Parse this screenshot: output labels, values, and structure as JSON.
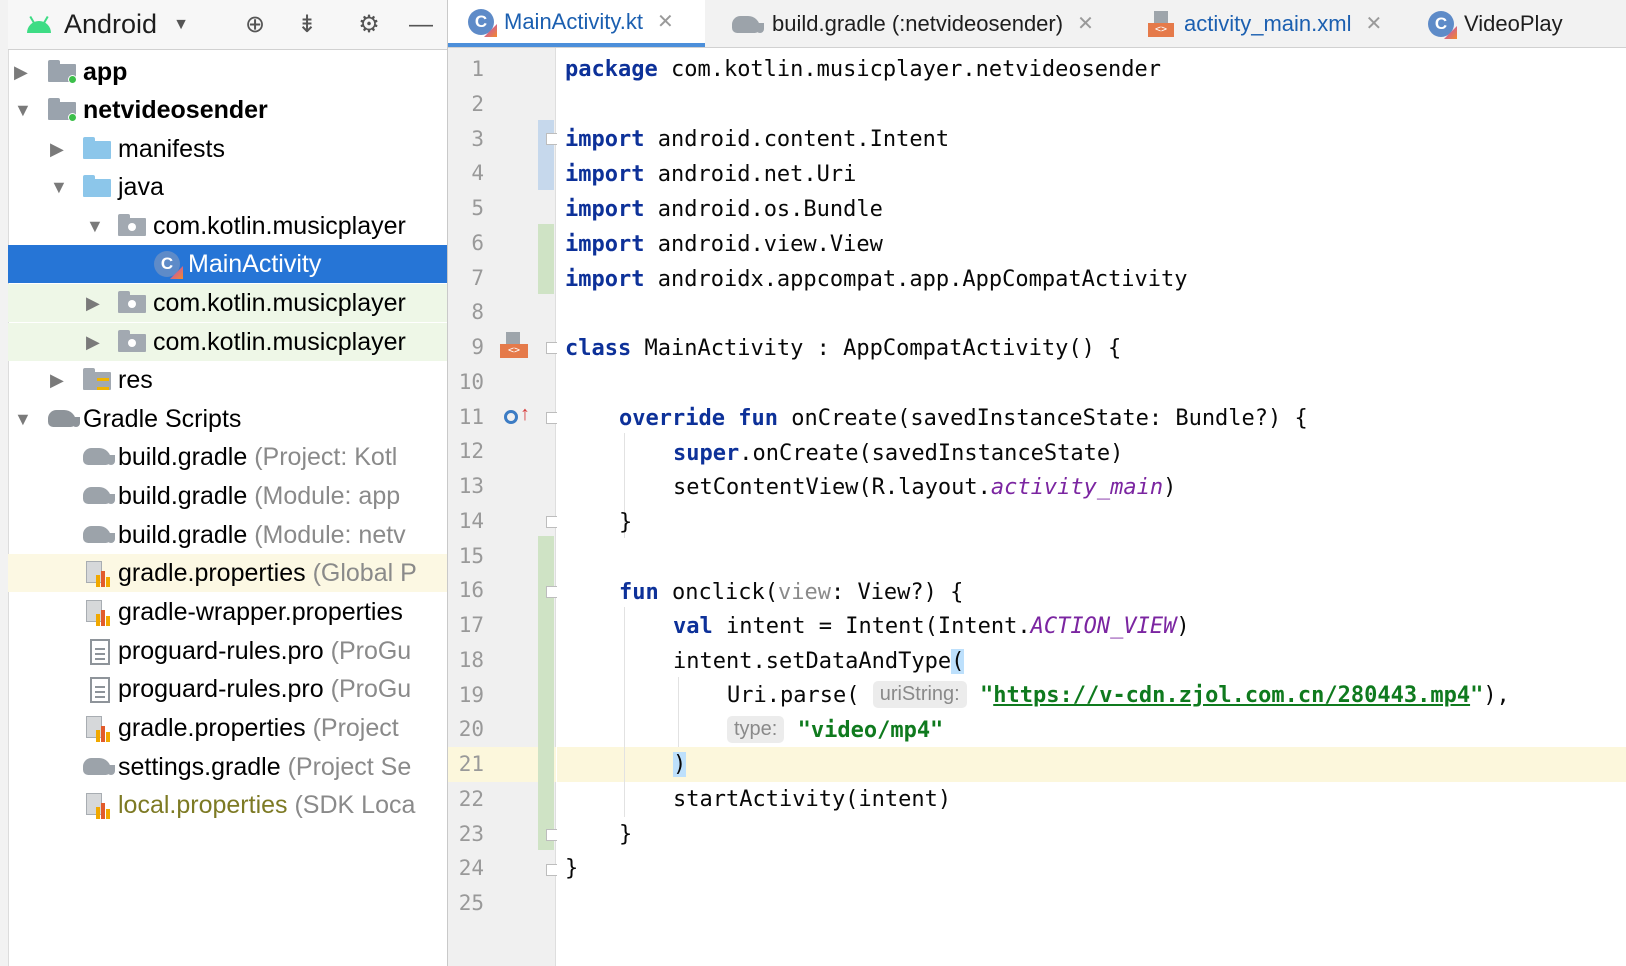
{
  "project_panel": {
    "view_label": "Android",
    "tree": [
      {
        "label": "app",
        "extra": ""
      },
      {
        "label": "netvideosender",
        "extra": ""
      },
      {
        "label": "manifests",
        "extra": ""
      },
      {
        "label": "java",
        "extra": ""
      },
      {
        "label": "com.kotlin.musicplayer",
        "extra": ""
      },
      {
        "label": "MainActivity",
        "extra": ""
      },
      {
        "label": "com.kotlin.musicplayer",
        "extra": ""
      },
      {
        "label": "com.kotlin.musicplayer",
        "extra": ""
      },
      {
        "label": "res",
        "extra": ""
      },
      {
        "label": "Gradle Scripts",
        "extra": ""
      },
      {
        "label": "build.gradle",
        "extra": "(Project: Kotl"
      },
      {
        "label": "build.gradle",
        "extra": "(Module: app"
      },
      {
        "label": "build.gradle",
        "extra": "(Module: netv"
      },
      {
        "label": "gradle.properties",
        "extra": "(Global P"
      },
      {
        "label": "gradle-wrapper.properties",
        "extra": ""
      },
      {
        "label": "proguard-rules.pro",
        "extra": "(ProGu"
      },
      {
        "label": "proguard-rules.pro",
        "extra": "(ProGu"
      },
      {
        "label": "gradle.properties",
        "extra": "(Project"
      },
      {
        "label": "settings.gradle",
        "extra": "(Project Se"
      },
      {
        "label": "local.properties",
        "extra": "(SDK Loca"
      }
    ]
  },
  "editor": {
    "tabs": [
      {
        "label": "MainActivity.kt",
        "icon": "kotlin-class-icon"
      },
      {
        "label": "build.gradle (:netvideosender)",
        "icon": "gradle-icon"
      },
      {
        "label": "activity_main.xml",
        "icon": "xml-layout-icon"
      },
      {
        "label": "VideoPlay",
        "icon": "kotlin-class-icon"
      }
    ],
    "line_numbers": [
      "1",
      "2",
      "3",
      "4",
      "5",
      "6",
      "7",
      "8",
      "9",
      "10",
      "11",
      "12",
      "13",
      "14",
      "15",
      "16",
      "17",
      "18",
      "19",
      "20",
      "21",
      "22",
      "23",
      "24",
      "25"
    ],
    "code": {
      "l1_kw": "package",
      "l1_rest": " com.kotlin.musicplayer.netvideosender",
      "imp_kw": "import",
      "l3": " android.content.Intent",
      "l4": " android.net.Uri",
      "l5": " android.os.Bundle",
      "l6": " android.view.View",
      "l7": " androidx.appcompat.app.AppCompatActivity",
      "l9_kw": "class",
      "l9_rest": " MainActivity : AppCompatActivity() {",
      "l11_kw1": "override",
      "l11_kw2": "fun",
      "l11_rest": " onCreate(savedInstanceState: Bundle?) {",
      "l12_kw": "super",
      "l12_rest": ".onCreate(savedInstanceState)",
      "l13_a": "setContentView(R.layout.",
      "l13_b": "activity_main",
      "l13_c": ")",
      "l14": "}",
      "l16_kw": "fun",
      "l16_a": " onclick(",
      "l16_b": "view",
      "l16_c": ": View?) {",
      "l17_kw": "val",
      "l17_a": " intent = Intent(Intent.",
      "l17_b": "ACTION_VIEW",
      "l17_c": ")",
      "l18_a": "intent.setDataAndType",
      "l18_b": "(",
      "l19_a": "Uri.parse(",
      "l19_hint": "uriString:",
      "l19_q1": "\"",
      "l19_url": "https://v-cdn.zjol.com.cn/280443.mp4",
      "l19_q2": "\"",
      "l19_c": "),",
      "l20_hint": "type:",
      "l20_str": "\"video/mp4\"",
      "l21": ")",
      "l22": "startActivity(intent)",
      "l23": "}",
      "l24": "}"
    },
    "current_line": 21
  },
  "colors": {
    "selection": "#2675d6",
    "keyword": "#0d3199",
    "string": "#0f7a1e",
    "constant": "#7b25a1",
    "current_line": "#fcf7dc"
  }
}
